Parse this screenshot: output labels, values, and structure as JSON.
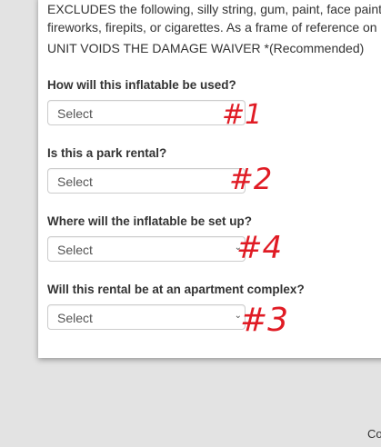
{
  "notice": {
    "lines": [
      "EXCLUDES the following, silly string, gum, paint, face paint,",
      "fireworks, firepits, or cigarettes. As a frame of reference on",
      "UNIT VOIDS THE DAMAGE WAIVER *(Recommended)"
    ]
  },
  "questions": [
    {
      "label": "How will this inflatable be used?",
      "value": "Select",
      "annotation": "#1"
    },
    {
      "label": "Is this a park rental?",
      "value": "Select",
      "annotation": "#2"
    },
    {
      "label": "Where will the inflatable be set up?",
      "value": "Select",
      "annotation": "#4"
    },
    {
      "label": "Will this rental be at an apartment complex?",
      "value": "Select",
      "annotation": "#3"
    }
  ],
  "annotation_color": "#e01b24",
  "footer": {
    "text": "Co"
  }
}
